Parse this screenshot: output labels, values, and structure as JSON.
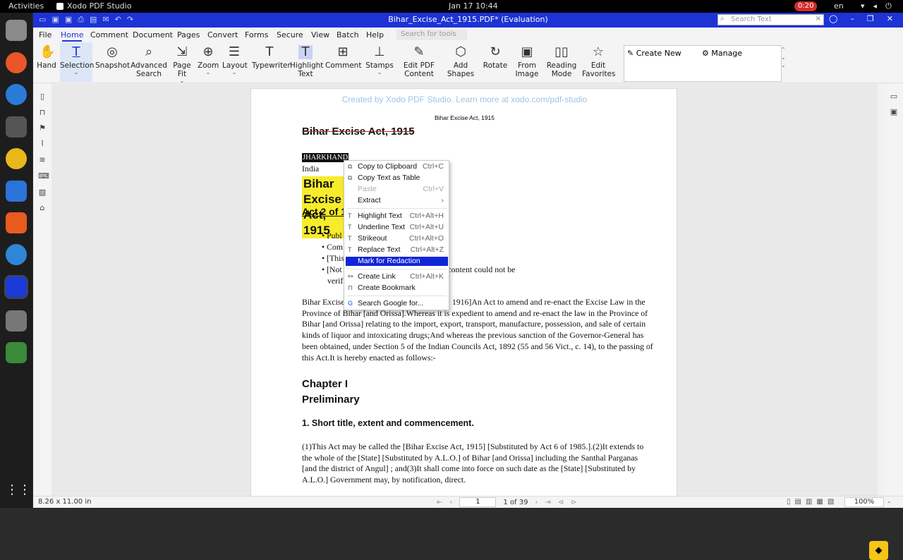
{
  "topbar": {
    "activities": "Activities",
    "app_name": "Xodo PDF Studio",
    "clock": "Jan 17  10:44",
    "recording": "0:20",
    "lang": "en"
  },
  "window": {
    "title": "Bihar_Excise_Act_1915.PDF* (Evaluation)",
    "search_placeholder": "Search Text"
  },
  "menu": [
    "File",
    "Home",
    "Comment",
    "Document",
    "Pages",
    "Convert",
    "Forms",
    "Secure",
    "View",
    "Batch",
    "Help"
  ],
  "tool_search_placeholder": "Search for tools ...",
  "ribbon": [
    {
      "label": "Hand",
      "icon": "hand-icon",
      "glyph": "✋"
    },
    {
      "label": "Selection",
      "icon": "selection-icon",
      "glyph": "T"
    },
    {
      "label": "Snapshot",
      "icon": "camera-icon",
      "glyph": "◎"
    },
    {
      "label": "Advanced Search",
      "icon": "advanced-search-icon",
      "glyph": "⌕"
    },
    {
      "label": "Page Fit",
      "icon": "page-fit-icon",
      "glyph": "⇲"
    },
    {
      "label": "Zoom",
      "icon": "zoom-icon",
      "glyph": "⊕"
    },
    {
      "label": "Layout",
      "icon": "layout-icon",
      "glyph": "☰"
    },
    {
      "label": "Typewriter",
      "icon": "typewriter-icon",
      "glyph": "T"
    },
    {
      "label": "Highlight Text",
      "icon": "highlight-text-icon",
      "glyph": "T"
    },
    {
      "label": "Comment",
      "icon": "comment-icon",
      "glyph": "⊞"
    },
    {
      "label": "Stamps",
      "icon": "stamp-icon",
      "glyph": "⊥"
    },
    {
      "label": "Edit PDF Content",
      "icon": "edit-pdf-icon",
      "glyph": "✎"
    },
    {
      "label": "Add Shapes",
      "icon": "shapes-icon",
      "glyph": "⬡"
    },
    {
      "label": "Rotate",
      "icon": "rotate-icon",
      "glyph": "↻"
    },
    {
      "label": "From Image",
      "icon": "from-image-icon",
      "glyph": "▣"
    },
    {
      "label": "Reading Mode",
      "icon": "reading-mode-icon",
      "glyph": "▯▯"
    },
    {
      "label": "Edit Favorites",
      "icon": "star-icon",
      "glyph": "☆"
    }
  ],
  "favorites": {
    "create_new": "Create New",
    "manage": "Manage"
  },
  "page": {
    "watermark": "Created by Xodo PDF Studio. Learn more at xodo.com/pdf-studio",
    "header": "Bihar Excise Act, 1915",
    "title": "Bihar Excise Act, 1915",
    "jurisdiction": "JHARKHAND",
    "country": "India",
    "title2": "Bihar Excise Act, 1915",
    "act": "Act 2 of 1915",
    "bullets": [
      "• Publ",
      "• Com",
      "• [This                                                 t from 19 January 1916.]",
      "• [Not                                                  ument is not available and this content could not be",
      "verif"
    ],
    "para1": "Bihar Excise                                              e of 1915)[Dated 19th January, 1916]An Act to amend and re-enact the Excise Law in the Province of Bihar [and Orissa].Whereas it is expedient to amend and re-enact the law in the Province of Bihar [and Orissa] relating to the import, export, transport, manufacture, possession, and sale of certain kinds of liquor and intoxicating drugs;And whereas the previous sanction of the Governor-General has been obtained, under Section 5 of the Indian Councils Act, 1892 (55 and 56 Vict., c. 14), to the passing of this Act.It is hereby enacted as follows:-",
    "chapter": "Chapter I",
    "chapter_name": "Preliminary",
    "section1": "1. Short title, extent and commencement.",
    "para2": "(1)This Act may be called the [Bihar Excise Act, 1915] [Substituted by Act 6 of 1985.].(2)It extends to the whole of the [State] [Substituted by A.L.O.] of Bihar [and Orissa] including the Santhal Parganas [and the district of Angul] ; and(3)It shall come into force on such date as the [State] [Substituted by A.L.O.] Government may, by notification, direct."
  },
  "context_menu": [
    {
      "label": "Copy to Clipboard",
      "shortcut": "Ctrl+C",
      "icon": "copy-icon",
      "glyph": "⧉"
    },
    {
      "label": "Copy Text as Table",
      "shortcut": "",
      "icon": "copy-table-icon",
      "glyph": "⧉"
    },
    {
      "label": "Paste",
      "shortcut": "Ctrl+V",
      "icon": "",
      "glyph": ""
    },
    {
      "label": "Extract",
      "shortcut": "›",
      "icon": "",
      "glyph": ""
    },
    {
      "label": "Highlight Text",
      "shortcut": "Ctrl+Alt+H",
      "icon": "highlight-icon",
      "glyph": "T"
    },
    {
      "label": "Underline Text",
      "shortcut": "Ctrl+Alt+U",
      "icon": "underline-icon",
      "glyph": "T"
    },
    {
      "label": "Strikeout",
      "shortcut": "Ctrl+Alt+O",
      "icon": "strikeout-icon",
      "glyph": "T"
    },
    {
      "label": "Replace Text",
      "shortcut": "Ctrl+Alt+Z",
      "icon": "replace-icon",
      "glyph": "T"
    },
    {
      "label": "Mark for Redaction",
      "shortcut": "",
      "icon": "",
      "glyph": ""
    },
    {
      "label": "Create Link",
      "shortcut": "Ctrl+Alt+K",
      "icon": "link-icon",
      "glyph": "⚯"
    },
    {
      "label": "Create Bookmark",
      "shortcut": "",
      "icon": "bookmark-icon",
      "glyph": "⊓"
    },
    {
      "label": "Search Google for...",
      "shortcut": "",
      "icon": "google-icon",
      "glyph": "G"
    }
  ],
  "status": {
    "page_size": "8.26 x 11.00 in",
    "page_num": "1",
    "page_of": "1 of 39",
    "zoom": "100%"
  },
  "colors": {
    "titlebar": "#1d33d6",
    "highlight": "#f7ec2b",
    "menu_select": "#1025d8",
    "strike": "#c62828"
  }
}
